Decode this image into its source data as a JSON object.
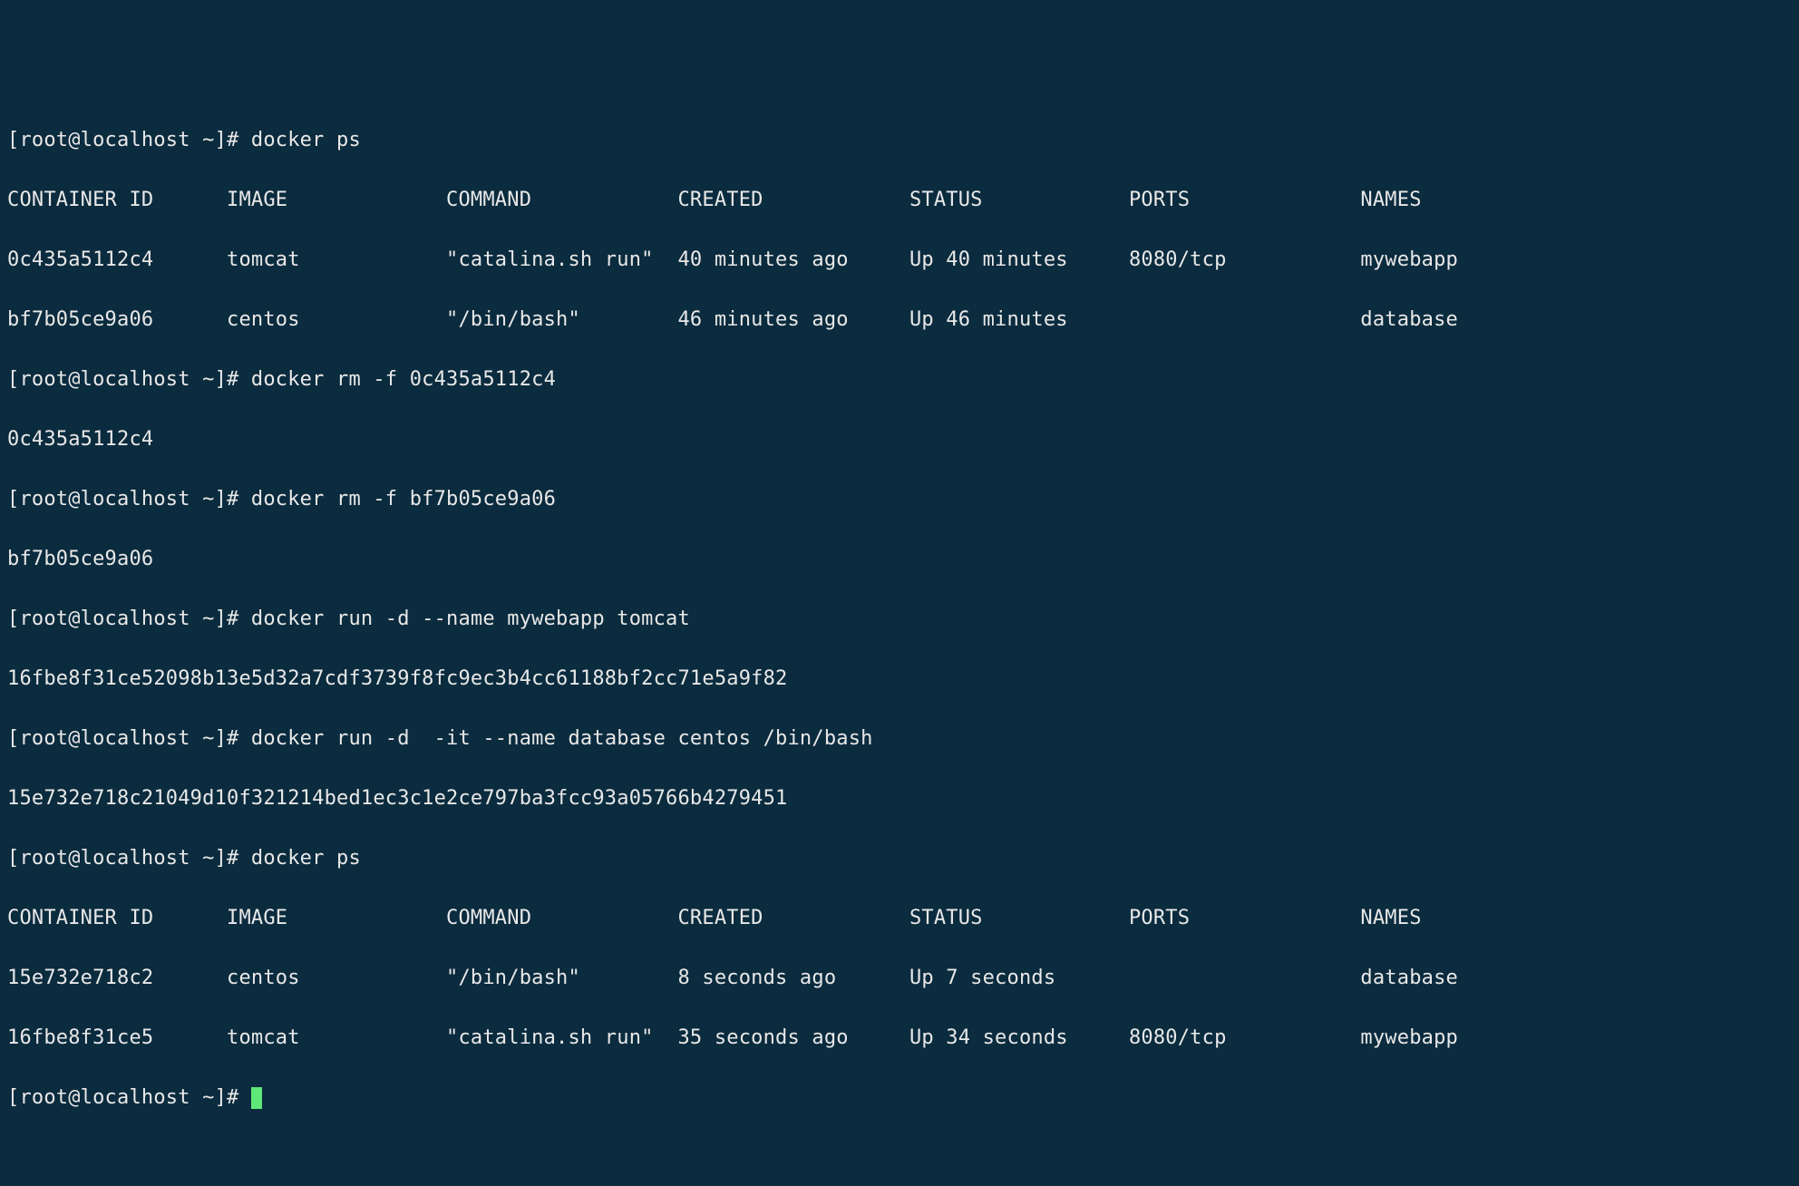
{
  "prompt": "[root@localhost ~]# ",
  "cmds": {
    "ps1": "docker ps",
    "rm1": "docker rm -f 0c435a5112c4",
    "rm2": "docker rm -f bf7b05ce9a06",
    "run1": "docker run -d --name mywebapp tomcat",
    "run2": "docker run -d  -it --name database centos /bin/bash",
    "ps2": "docker ps"
  },
  "header": {
    "c0": "CONTAINER ID",
    "c1": "IMAGE",
    "c2": "COMMAND",
    "c3": "CREATED",
    "c4": "STATUS",
    "c5": "PORTS",
    "c6": "NAMES"
  },
  "ps1_rows": [
    {
      "id": "0c435a5112c4",
      "image": "tomcat",
      "command": "\"catalina.sh run\"",
      "created": "40 minutes ago",
      "status": "Up 40 minutes",
      "ports": "8080/tcp",
      "names": "mywebapp"
    },
    {
      "id": "bf7b05ce9a06",
      "image": "centos",
      "command": "\"/bin/bash\"",
      "created": "46 minutes ago",
      "status": "Up 46 minutes",
      "ports": "",
      "names": "database"
    }
  ],
  "rm1_out": "0c435a5112c4",
  "rm2_out": "bf7b05ce9a06",
  "run1_out": "16fbe8f31ce52098b13e5d32a7cdf3739f8fc9ec3b4cc61188bf2cc71e5a9f82",
  "run2_out": "15e732e718c21049d10f321214bed1ec3c1e2ce797ba3fcc93a05766b4279451",
  "ps2_rows": [
    {
      "id": "15e732e718c2",
      "image": "centos",
      "command": "\"/bin/bash\"",
      "created": "8 seconds ago",
      "status": "Up 7 seconds",
      "ports": "",
      "names": "database"
    },
    {
      "id": "16fbe8f31ce5",
      "image": "tomcat",
      "command": "\"catalina.sh run\"",
      "created": "35 seconds ago",
      "status": "Up 34 seconds",
      "ports": "8080/tcp",
      "names": "mywebapp"
    }
  ],
  "cols": {
    "c0": 18,
    "c1": 18,
    "c2": 19,
    "c3": 19,
    "c4": 18,
    "c5": 19
  },
  "last_prompt_partial": "[root@localhost ~]# "
}
